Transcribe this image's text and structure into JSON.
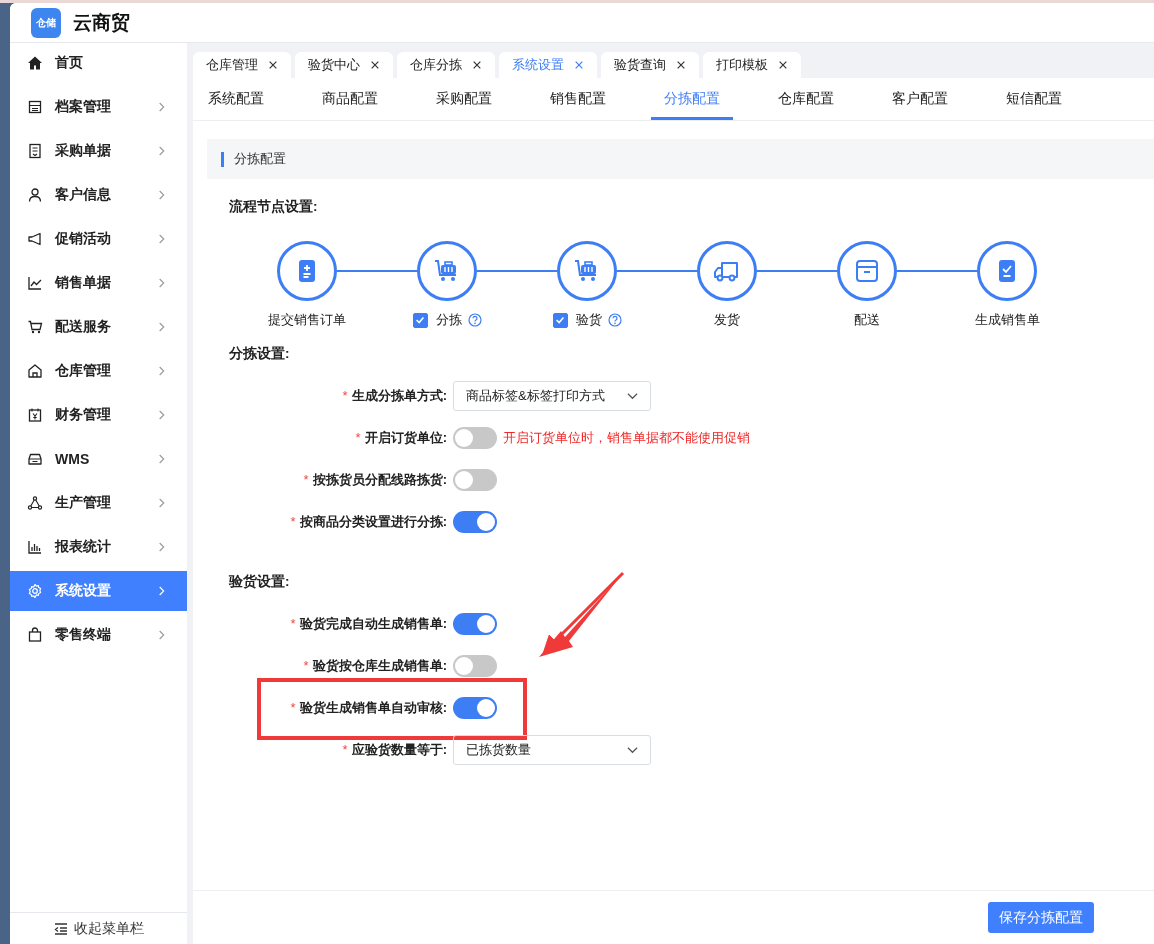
{
  "app": {
    "title": "云商贸",
    "logo_text": "仓储"
  },
  "sidebar": {
    "items": [
      {
        "label": "首页",
        "selected": false,
        "has_arrow": false
      },
      {
        "label": "档案管理",
        "selected": false,
        "has_arrow": true
      },
      {
        "label": "采购单据",
        "selected": false,
        "has_arrow": true
      },
      {
        "label": "客户信息",
        "selected": false,
        "has_arrow": true
      },
      {
        "label": "促销活动",
        "selected": false,
        "has_arrow": true
      },
      {
        "label": "销售单据",
        "selected": false,
        "has_arrow": true
      },
      {
        "label": "配送服务",
        "selected": false,
        "has_arrow": true
      },
      {
        "label": "仓库管理",
        "selected": false,
        "has_arrow": true
      },
      {
        "label": "财务管理",
        "selected": false,
        "has_arrow": true
      },
      {
        "label": "WMS",
        "selected": false,
        "has_arrow": true
      },
      {
        "label": "生产管理",
        "selected": false,
        "has_arrow": true
      },
      {
        "label": "报表统计",
        "selected": false,
        "has_arrow": true
      },
      {
        "label": "系统设置",
        "selected": true,
        "has_arrow": true
      },
      {
        "label": "零售终端",
        "selected": false,
        "has_arrow": true
      }
    ],
    "collapse": "收起菜单栏"
  },
  "page_tabs": [
    {
      "label": "仓库管理",
      "selected": false
    },
    {
      "label": "验货中心",
      "selected": false
    },
    {
      "label": "仓库分拣",
      "selected": false
    },
    {
      "label": "系统设置",
      "selected": true
    },
    {
      "label": "验货查询",
      "selected": false
    },
    {
      "label": "打印模板",
      "selected": false
    }
  ],
  "config_tabs": [
    {
      "label": "系统配置",
      "selected": false
    },
    {
      "label": "商品配置",
      "selected": false
    },
    {
      "label": "采购配置",
      "selected": false
    },
    {
      "label": "销售配置",
      "selected": false
    },
    {
      "label": "分拣配置",
      "selected": true
    },
    {
      "label": "仓库配置",
      "selected": false
    },
    {
      "label": "客户配置",
      "selected": false
    },
    {
      "label": "短信配置",
      "selected": false
    }
  ],
  "section_title": "分拣配置",
  "flow": {
    "title": "流程节点设置:",
    "steps": [
      {
        "label": "提交销售订单",
        "kind": "plain"
      },
      {
        "label": "分拣",
        "kind": "checkbox",
        "checked": true
      },
      {
        "label": "验货",
        "kind": "checkbox",
        "checked": true
      },
      {
        "label": "发货",
        "kind": "plain"
      },
      {
        "label": "配送",
        "kind": "plain"
      },
      {
        "label": "生成销售单",
        "kind": "plain"
      }
    ]
  },
  "groups": [
    {
      "title": "分拣设置:",
      "rows": [
        {
          "kind": "select",
          "label": "生成分拣单方式:",
          "required_mark": "*",
          "value": "商品标签&标签打印方式",
          "highlighted": false
        },
        {
          "kind": "switch",
          "label": "开启订货单位:",
          "required_mark": "*",
          "on": false,
          "hint": "开启订货单位时，销售单据都不能使用促销",
          "highlighted": false
        },
        {
          "kind": "switch",
          "label": "按拣货员分配线路拣货:",
          "required_mark": "*",
          "on": false,
          "highlighted": false
        },
        {
          "kind": "switch",
          "label": "按商品分类设置进行分拣:",
          "required_mark": "*",
          "on": true,
          "highlighted": false
        }
      ]
    },
    {
      "title": "验货设置:",
      "rows": [
        {
          "kind": "switch",
          "label": "验货完成自动生成销售单:",
          "required_mark": "*",
          "on": true,
          "highlighted": false
        },
        {
          "kind": "switch",
          "label": "验货按仓库生成销售单:",
          "required_mark": "*",
          "on": false,
          "highlighted": false
        },
        {
          "kind": "switch",
          "label": "验货生成销售单自动审核:",
          "required_mark": "*",
          "on": true,
          "highlighted": true
        },
        {
          "kind": "select",
          "label": "应验货数量等于:",
          "required_mark": "*",
          "value": "已拣货数量",
          "highlighted": false
        }
      ]
    }
  ],
  "save_button": "保存分拣配置"
}
